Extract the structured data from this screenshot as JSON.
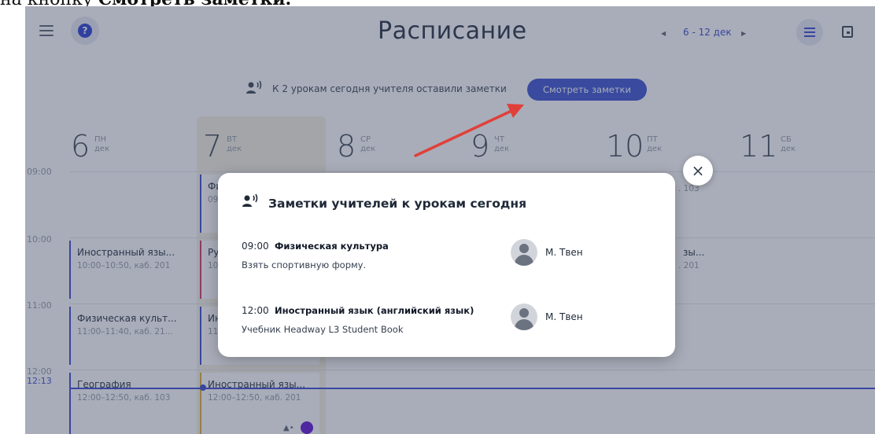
{
  "caption": {
    "prefix": "на кнопку ",
    "bold": "Смотреть заметки."
  },
  "header": {
    "menu_icon": "menu-icon",
    "help_icon": "help-icon",
    "help_glyph": "?",
    "title": "Расписание",
    "week_prev_icon": "chevron-left-icon",
    "week_range": "6 - 12 дек",
    "week_next_icon": "chevron-right-icon",
    "view_list_icon": "list-view-icon",
    "view_calendar_icon": "calendar-icon"
  },
  "notes_banner": {
    "icon": "teacher-speaking-icon",
    "text": "К 2 урокам сегодня учителя оставили заметки",
    "button": "Смотреть заметки"
  },
  "days": [
    {
      "num": "6",
      "dow": "ПН",
      "month": "дек"
    },
    {
      "num": "7",
      "dow": "ВТ",
      "month": "дек"
    },
    {
      "num": "8",
      "dow": "СР",
      "month": "дек"
    },
    {
      "num": "9",
      "dow": "ЧТ",
      "month": "дек"
    },
    {
      "num": "10",
      "dow": "ПТ",
      "month": "дек"
    },
    {
      "num": "11",
      "dow": "СБ",
      "month": "дек"
    }
  ],
  "times": [
    "09:00",
    "10:00",
    "11:00",
    "12:00",
    "12:13"
  ],
  "lessons": {
    "mon_10": {
      "title": "Иностранный язы...",
      "sub": "10:00–10:50, каб. 201"
    },
    "mon_11": {
      "title": "Физическая культ...",
      "sub": "11:00–11:40, каб. 21..."
    },
    "mon_12": {
      "title": "География",
      "sub": "12:00–12:50, каб. 103"
    },
    "tue_09": {
      "title": "Фи",
      "sub": "09"
    },
    "tue_10": {
      "title": "Ру",
      "sub": "10"
    },
    "tue_11": {
      "title": "Ин",
      "sub": "11"
    },
    "tue_12": {
      "title": "Иностранный язы...",
      "sub": "12:00–12:50, каб. 201"
    },
    "fri_09": {
      "title": "",
      "sub": ". 103"
    },
    "fri_10": {
      "title": "зы...",
      "sub": ". 201"
    }
  },
  "modal": {
    "icon": "teacher-speaking-icon",
    "title": "Заметки учителей к урокам сегодня",
    "close_glyph": "×",
    "notes": [
      {
        "time": "09:00",
        "subject": "Физическая культура",
        "text": "Взять спортивную форму.",
        "teacher": "М. Твен"
      },
      {
        "time": "12:00",
        "subject": "Иностранный язык (английский язык)",
        "text": "Учебник Headway L3 Student Book",
        "teacher": "М. Твен"
      }
    ]
  },
  "colors": {
    "accent": "#4b5fd6",
    "annotation_arrow": "#e0403a",
    "overlay": "rgba(30,40,70,0.38)"
  }
}
